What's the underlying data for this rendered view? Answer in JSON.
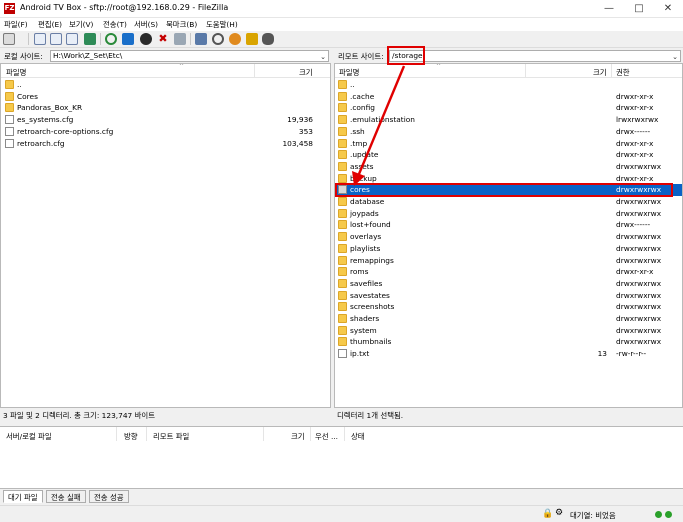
{
  "window": {
    "title": "Android TV Box - sftp://root@192.168.0.29 - FileZilla",
    "app_icon_text": "FZ",
    "controls": [
      "minimize",
      "maximize",
      "close"
    ]
  },
  "menu": [
    "파일(F)",
    "편집(E)",
    "보기(V)",
    "전송(T)",
    "서버(S)",
    "북마크(B)",
    "도움말(H)"
  ],
  "toolbar": {
    "icons": [
      "site-manager-icon",
      "toggle-log-icon",
      "toggle-local-tree-icon",
      "toggle-remote-tree-icon",
      "toggle-queue-icon",
      "refresh-icon",
      "process-queue-icon",
      "cancel-icon",
      "disconnect-icon",
      "reconnect-icon",
      "filter-icon",
      "search-files-icon",
      "compare-icon",
      "sync-browse-icon",
      "find-icon"
    ]
  },
  "local": {
    "site_label": "로컬 사이트:",
    "path": "H:\\Work\\Z_Set\\Etc\\",
    "headers": {
      "name": "파일명",
      "size": "크기"
    },
    "rows": [
      {
        "name": "..",
        "type": "folder",
        "size": ""
      },
      {
        "name": "Cores",
        "type": "folder",
        "size": ""
      },
      {
        "name": "Pandoras_Box_KR",
        "type": "folder",
        "size": ""
      },
      {
        "name": "es_systems.cfg",
        "type": "file",
        "size": "19,936"
      },
      {
        "name": "retroarch-core-options.cfg",
        "type": "file",
        "size": "353"
      },
      {
        "name": "retroarch.cfg",
        "type": "file",
        "size": "103,458"
      }
    ],
    "status": "3 파일 및 2 디렉터리. 총 크기: 123,747 바이트"
  },
  "remote": {
    "site_label": "리모트 사이트:",
    "path": "/storage",
    "headers": {
      "name": "파일명",
      "size": "크기",
      "perm": "권한"
    },
    "rows": [
      {
        "name": "..",
        "type": "folder",
        "size": "",
        "perm": ""
      },
      {
        "name": ".cache",
        "type": "folder",
        "size": "",
        "perm": "drwxr-xr-x"
      },
      {
        "name": ".config",
        "type": "folder",
        "size": "",
        "perm": "drwxr-xr-x"
      },
      {
        "name": ".emulationstation",
        "type": "folder",
        "size": "",
        "perm": "lrwxrwxrwx"
      },
      {
        "name": ".ssh",
        "type": "folder",
        "size": "",
        "perm": "drwx------"
      },
      {
        "name": ".tmp",
        "type": "folder",
        "size": "",
        "perm": "drwxr-xr-x"
      },
      {
        "name": ".update",
        "type": "folder",
        "size": "",
        "perm": "drwxr-xr-x"
      },
      {
        "name": "assets",
        "type": "folder",
        "size": "",
        "perm": "drwxrwxrwx"
      },
      {
        "name": "backup",
        "type": "folder",
        "size": "",
        "perm": "drwxr-xr-x"
      },
      {
        "name": "cores",
        "type": "folder-grey",
        "size": "",
        "perm": "drwxrwxrwx",
        "selected": true
      },
      {
        "name": "database",
        "type": "folder",
        "size": "",
        "perm": "drwxrwxrwx"
      },
      {
        "name": "joypads",
        "type": "folder",
        "size": "",
        "perm": "drwxrwxrwx"
      },
      {
        "name": "lost+found",
        "type": "folder",
        "size": "",
        "perm": "drwx------"
      },
      {
        "name": "overlays",
        "type": "folder",
        "size": "",
        "perm": "drwxrwxrwx"
      },
      {
        "name": "playlists",
        "type": "folder",
        "size": "",
        "perm": "drwxrwxrwx"
      },
      {
        "name": "remappings",
        "type": "folder",
        "size": "",
        "perm": "drwxrwxrwx"
      },
      {
        "name": "roms",
        "type": "folder",
        "size": "",
        "perm": "drwxr-xr-x"
      },
      {
        "name": "savefiles",
        "type": "folder",
        "size": "",
        "perm": "drwxrwxrwx"
      },
      {
        "name": "savestates",
        "type": "folder",
        "size": "",
        "perm": "drwxrwxrwx"
      },
      {
        "name": "screenshots",
        "type": "folder",
        "size": "",
        "perm": "drwxrwxrwx"
      },
      {
        "name": "shaders",
        "type": "folder",
        "size": "",
        "perm": "drwxrwxrwx"
      },
      {
        "name": "system",
        "type": "folder",
        "size": "",
        "perm": "drwxrwxrwx"
      },
      {
        "name": "thumbnails",
        "type": "folder",
        "size": "",
        "perm": "drwxrwxrwx"
      },
      {
        "name": "ip.txt",
        "type": "file",
        "size": "13",
        "perm": "-rw-r--r--"
      }
    ],
    "status": "디렉터리 1개 선택됨."
  },
  "queue": {
    "headers": [
      "서버/로컬 파일",
      "방향",
      "리모트 파일",
      "크기",
      "우선 ...",
      "상태"
    ]
  },
  "tabs": [
    "대기 파일",
    "전송 실패",
    "전송 성공"
  ],
  "statusbar": {
    "queue_text": "대기열: 비었음"
  },
  "colors": {
    "selection": "#0a62c6",
    "annotation": "#e00000",
    "folder": "#f6c94a"
  }
}
